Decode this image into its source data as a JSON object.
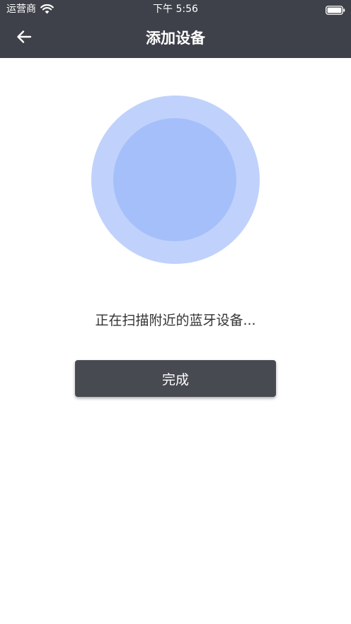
{
  "status_bar": {
    "carrier": "运营商",
    "time": "下午 5:56",
    "wifi_icon": "wifi-icon",
    "battery_icon": "battery-icon"
  },
  "nav": {
    "back_icon": "arrow-left-icon",
    "title": "添加设备"
  },
  "scan": {
    "outer_color": "#c0d2fb",
    "inner_color": "#a5bffb",
    "status_text": "正在扫描附近的蓝牙设备..."
  },
  "actions": {
    "done_label": "完成"
  },
  "colors": {
    "header_bg": "#3e4149",
    "button_bg": "#484a52"
  }
}
